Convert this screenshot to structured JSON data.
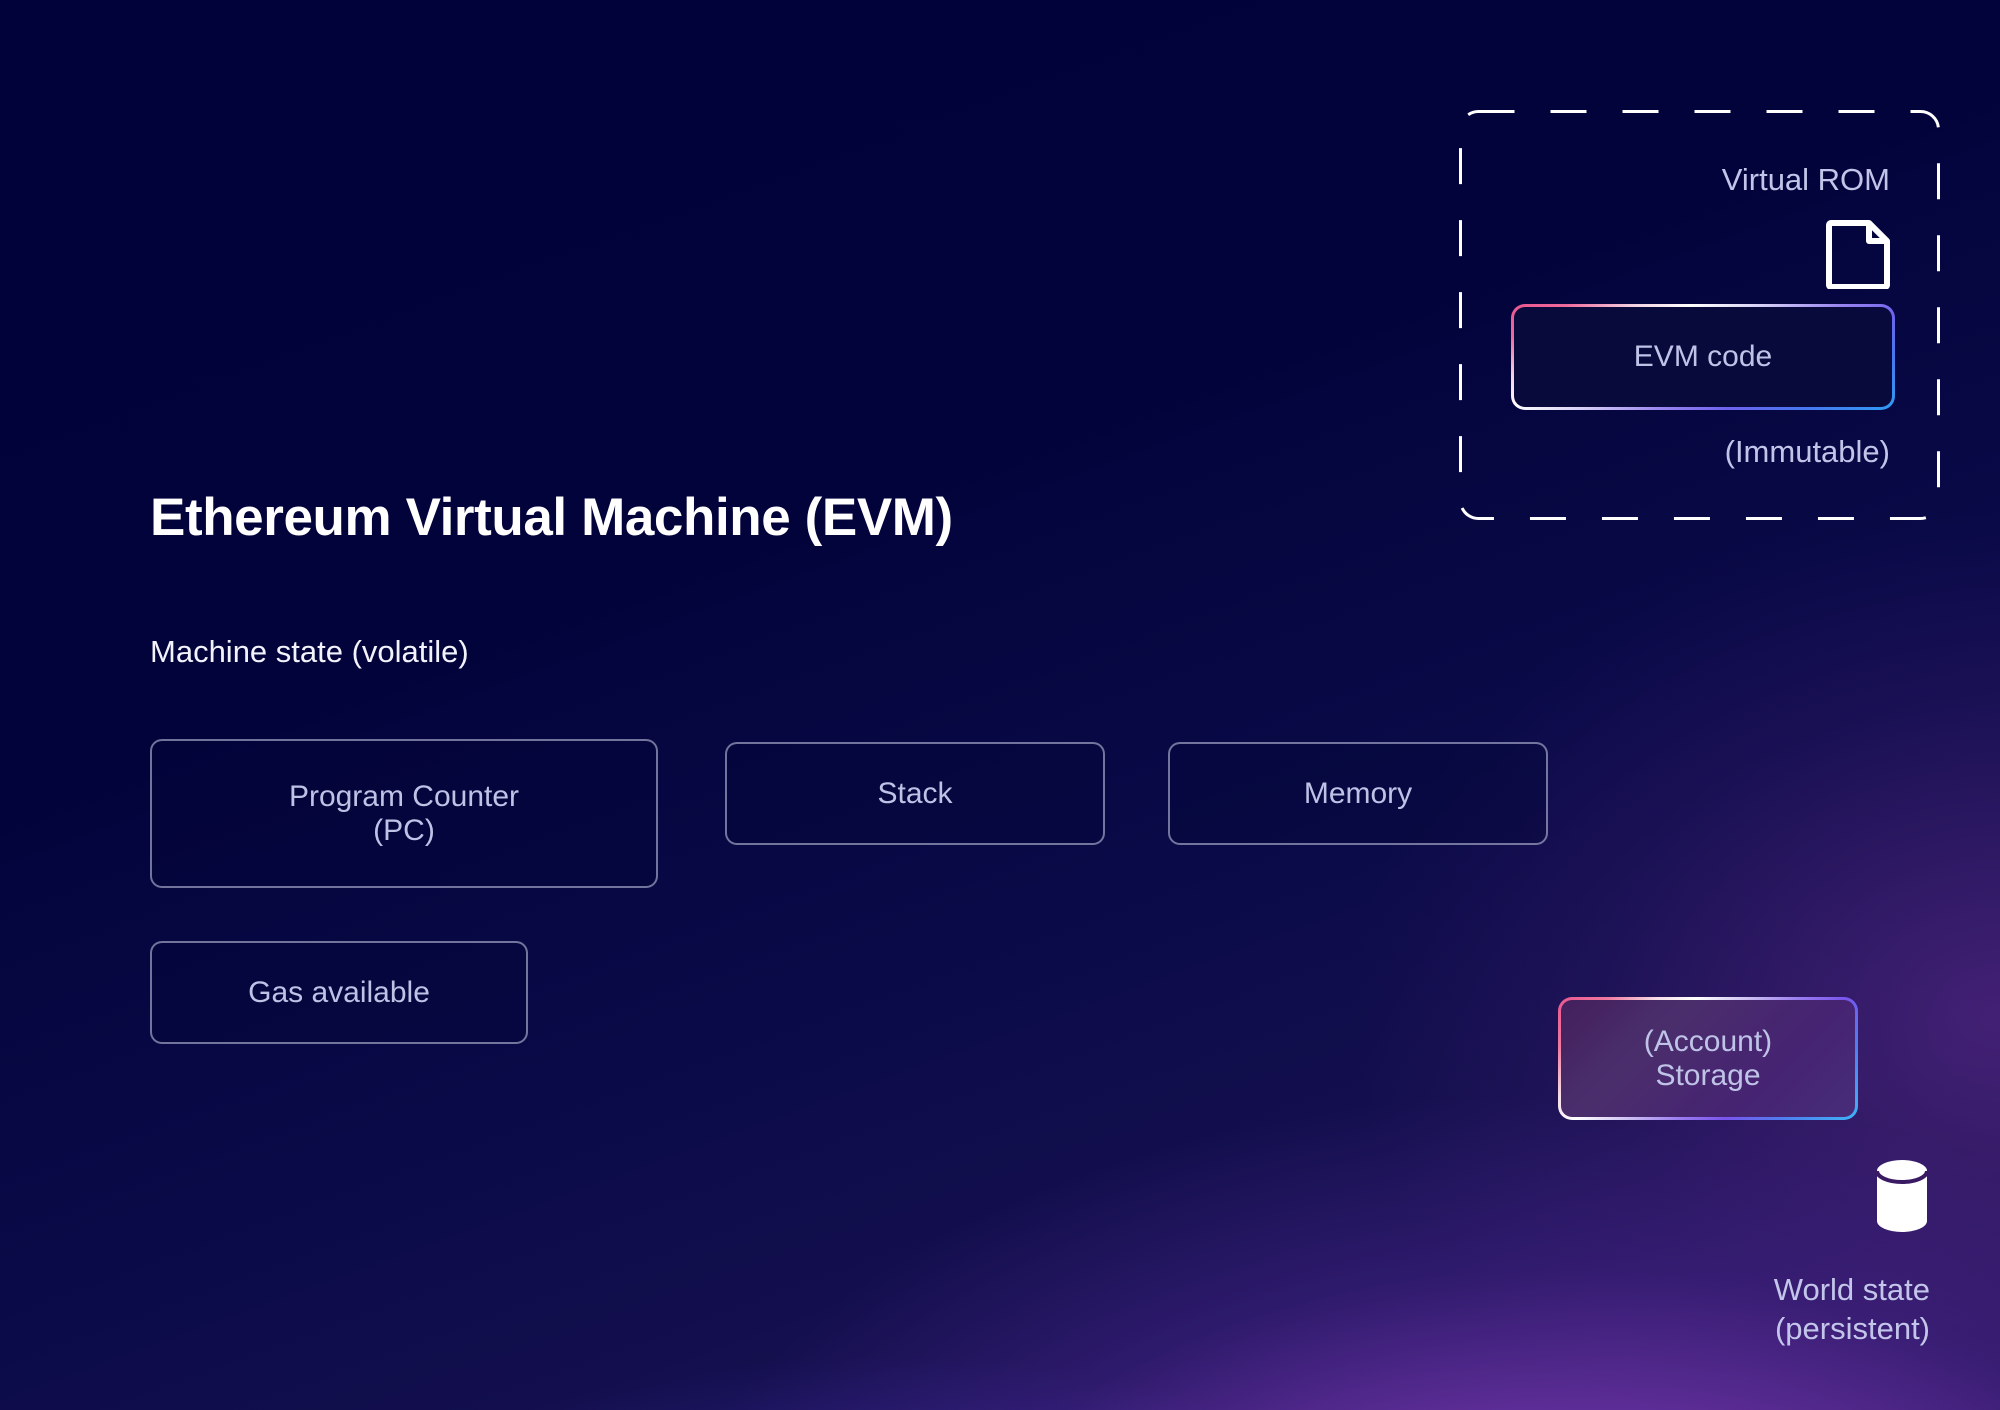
{
  "diagram": {
    "title": "Ethereum Virtual Machine (EVM)",
    "subtitle": "Machine state (volatile)"
  },
  "machine_state": {
    "boxes": [
      {
        "label": "Program Counter\n(PC)",
        "line1": "Program Counter",
        "line2": "(PC)"
      },
      {
        "label": "Stack"
      },
      {
        "label": "Memory"
      },
      {
        "label": "Gas available"
      }
    ]
  },
  "virtual_rom": {
    "title": "Virtual ROM",
    "code_box_label": "EVM code",
    "note": "(Immutable)",
    "doc_icon": "document-icon"
  },
  "storage": {
    "line1": "(Account)",
    "line2": "Storage",
    "db_icon": "database-cylinder-icon",
    "world_state_line1": "World state",
    "world_state_line2": "(persistent)"
  },
  "colors": {
    "background_dark": "#02023a",
    "background_accent_purple": "#b054dc",
    "background_accent_blue": "#5c46eb",
    "box_text": "#bec2e6",
    "title_text": "#ffffff",
    "gradient_pink": "#e8558f",
    "gradient_white": "#ffffff",
    "gradient_violet": "#7a55ee",
    "gradient_cyan": "#3fb4f6",
    "dashed_border": "#ffffff"
  }
}
